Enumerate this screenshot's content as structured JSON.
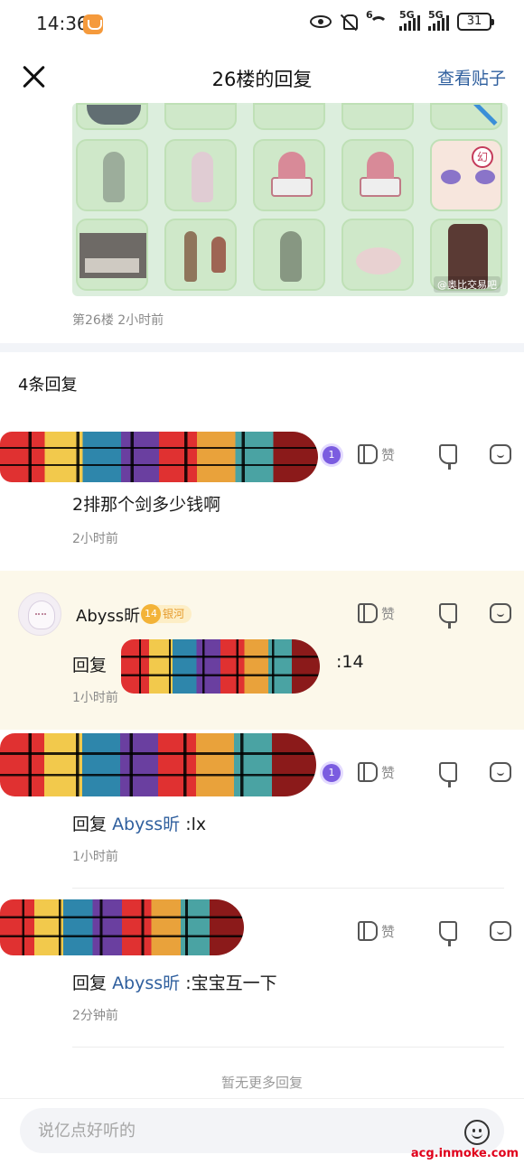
{
  "status_bar": {
    "time": "14:36",
    "network_5g_1": "5G",
    "network_5g_2": "5G",
    "battery": "31",
    "icons": [
      "app-notification-icon",
      "eye-icon",
      "bell-muted-icon",
      "wifi-icon",
      "signal-icon",
      "battery-icon"
    ]
  },
  "header": {
    "title": "26楼的回复",
    "view_post": "查看贴子"
  },
  "post_images": {
    "watermark": "@奥比交易吧",
    "badge": "幻"
  },
  "floor_meta": "第26楼 2小时前",
  "reply_count": "4条回复",
  "replies": [
    {
      "author_redacted": true,
      "badge": "1",
      "text": "2排那个剑多少钱啊",
      "time": "2小时前"
    },
    {
      "author": "Abyss昕",
      "level": "14",
      "level_title": "银河",
      "reply_prefix": "回复",
      "suffix": ":14",
      "time": "1小时前"
    },
    {
      "author_redacted": true,
      "badge": "1",
      "reply_prefix": "回复",
      "mention": "Abyss昕",
      "suffix": ":lx",
      "time": "1小时前"
    },
    {
      "author_redacted": true,
      "reply_prefix": "回复",
      "mention": "Abyss昕",
      "suffix": ":宝宝互一下",
      "time": "2分钟前"
    }
  ],
  "actions": {
    "like_label": "赞"
  },
  "no_more": "暂无更多回复",
  "input": {
    "placeholder": "说亿点好听的"
  },
  "site_watermark": "acg.inmoke.com",
  "colors": {
    "link": "#2f5f9e",
    "highlight_bg": "#fcf8ea",
    "level_badge": "#f3b338",
    "purple_badge": "#7b5ce0"
  }
}
